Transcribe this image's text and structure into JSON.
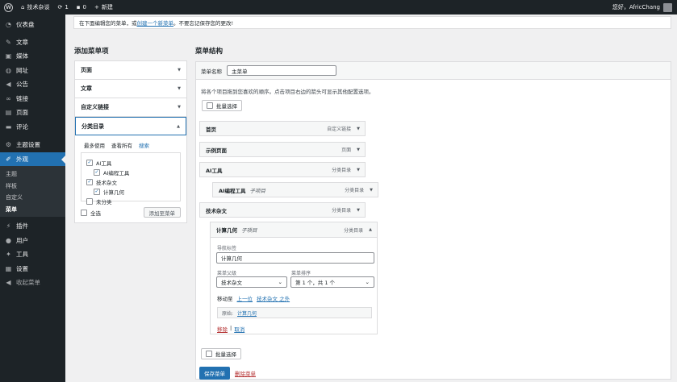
{
  "adminbar": {
    "site_name": "技术杂谈",
    "updates_count": "1",
    "comments_count": "0",
    "new_label": "新建",
    "greeting": "您好，AfricChang"
  },
  "sidebar": {
    "items": [
      {
        "label": "仪表盘",
        "icon": "dashboard-icon"
      },
      {
        "label": "文章",
        "icon": "pin-icon"
      },
      {
        "label": "媒体",
        "icon": "media-icon"
      },
      {
        "label": "网址",
        "icon": "globe-icon"
      },
      {
        "label": "公告",
        "icon": "megaphone-icon"
      },
      {
        "label": "链接",
        "icon": "link-icon"
      },
      {
        "label": "页面",
        "icon": "page-icon"
      },
      {
        "label": "评论",
        "icon": "comment-icon"
      },
      {
        "label": "主题设置",
        "icon": "gear-icon"
      },
      {
        "label": "外观",
        "icon": "brush-icon"
      },
      {
        "label": "插件",
        "icon": "plugin-icon"
      },
      {
        "label": "用户",
        "icon": "user-icon"
      },
      {
        "label": "工具",
        "icon": "wrench-icon"
      },
      {
        "label": "设置",
        "icon": "settings-icon"
      },
      {
        "label": "收起菜单",
        "icon": "collapse-icon"
      }
    ],
    "submenu": [
      "主题",
      "样板",
      "自定义",
      "菜单"
    ]
  },
  "notice": {
    "text_before": "在下面编辑您的菜单，或",
    "link": "创建一个新菜单",
    "text_after": "。不要忘记保存您的更改!"
  },
  "add_items": {
    "title": "添加菜单项",
    "sections": [
      "页面",
      "文章",
      "自定义链接",
      "分类目录"
    ],
    "tabs": [
      "最多使用",
      "查看所有",
      "搜索"
    ],
    "categories": [
      {
        "label": "AI工具",
        "checked": true
      },
      {
        "label": "AI编程工具",
        "checked": true
      },
      {
        "label": "技术杂文",
        "checked": true
      },
      {
        "label": "计算几何",
        "checked": true
      },
      {
        "label": "未分类",
        "checked": false
      }
    ],
    "select_all": "全选",
    "add_button": "添加至菜单"
  },
  "structure": {
    "title": "菜单结构",
    "name_label": "菜单名称",
    "name_value": "主菜单",
    "instructions": "将各个项目拖到您喜欢的顺序。点击项目右边的箭头可显示其他配置选项。",
    "bulk_select": "批量选择",
    "items": [
      {
        "title": "首页",
        "sub": "",
        "type": "自定义链接"
      },
      {
        "title": "示例页面",
        "sub": "",
        "type": "页面"
      },
      {
        "title": "AI工具",
        "sub": "",
        "type": "分类目录"
      },
      {
        "title": "AI编程工具",
        "sub": "子项目",
        "type": "分类目录"
      },
      {
        "title": "技术杂文",
        "sub": "",
        "type": "分类目录"
      }
    ],
    "expanded": {
      "title": "计算几何",
      "sub": "子项目",
      "type": "分类目录",
      "nav_label_caption": "导航标签",
      "nav_label_value": "计算几何",
      "parent_caption": "菜单父级",
      "parent_value": "技术杂文",
      "order_caption": "菜单排序",
      "order_value": "第 1 个，共 1 个",
      "move_label": "移动至",
      "move_up": "上一位",
      "move_out": "技术杂文 之外",
      "original_label": "原始:",
      "original_link": "计算几何",
      "remove": "移除",
      "separator": "|",
      "cancel": "取消"
    },
    "save_button": "保存菜单",
    "delete_link": "删除菜单"
  }
}
